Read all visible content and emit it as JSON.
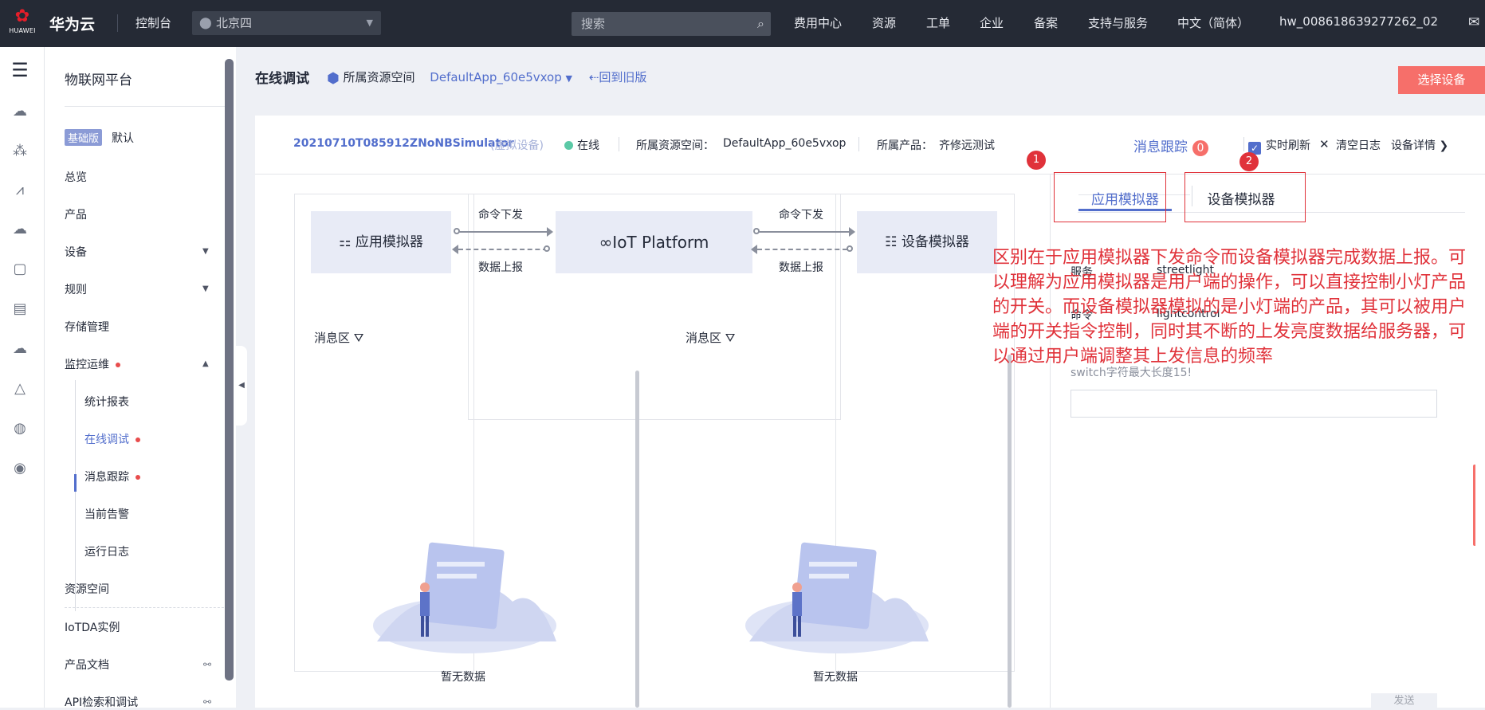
{
  "topbar": {
    "logo_text": "HUAWEI",
    "brand": "华为云",
    "console": "控制台",
    "region": "北京四",
    "search_placeholder": "搜索",
    "nav": [
      "费用中心",
      "资源",
      "工单",
      "企业",
      "备案",
      "支持与服务",
      "中文（简体）",
      "hw_008618639277262_02"
    ]
  },
  "sidenav": {
    "title": "物联网平台",
    "edition_badge": "基础版",
    "edition_label": "默认",
    "items": {
      "overview": "总览",
      "product": "产品",
      "device": "设备",
      "rules": "规则",
      "storage": "存储管理",
      "monitor": "监控运维",
      "resource_space": "资源空间",
      "iotda": "IoTDA实例",
      "docs": "产品文档",
      "api": "API检索和调试"
    },
    "sub_items": {
      "stats": "统计报表",
      "online_debug": "在线调试",
      "msg_trace": "消息跟踪",
      "alarms": "当前告警",
      "logs": "运行日志"
    }
  },
  "page": {
    "title": "在线调试",
    "resource_space_label": "所属资源空间",
    "app_name": "DefaultApp_60e5vxop",
    "back_old": "回到旧版",
    "select_device": "选择设备"
  },
  "devbar": {
    "device_id": "20210710T085912ZNoNBSimulator",
    "virtual": "(虚拟设备)",
    "status": "在线",
    "space_label": "所属资源空间：",
    "space_value": "DefaultApp_60e5vxop",
    "product_label": "所属产品：",
    "product_value": "齐修远测试",
    "trace_label": "消息跟踪",
    "trace_count": "0",
    "realtime": "实时刷新",
    "clear_log": "清空日志",
    "device_detail": "设备详情"
  },
  "diagram": {
    "app_sim": "应用模拟器",
    "platform": "IoT Platform",
    "dev_sim": "设备模拟器",
    "cmd_down": "命令下发",
    "data_up": "数据上报"
  },
  "message_area": {
    "title": "消息区",
    "empty": "暂无数据"
  },
  "simulator": {
    "tab_app": "应用模拟器",
    "tab_device": "设备模拟器",
    "marker1": "1",
    "marker2": "2",
    "service_label": "服务",
    "service_value": "streetlight",
    "command_label": "命令",
    "command_value": "lightcontrol",
    "hint": "switch字符最大长度15!",
    "send": "发送"
  },
  "annotation": "区别在于应用模拟器下发命令而设备模拟器完成数据上报。可以理解为应用模拟器是用户端的操作，可以直接控制小灯产品的开关。而设备模拟器模拟的是小灯端的产品，其可以被用户端的开关指令控制，同时其不断的上发亮度数据给服务器，可以通过用户端调整其上发信息的频率",
  "colors": {
    "topbar": "#252a35",
    "accent": "#526ecc",
    "primary_button": "#f66f6a",
    "annotation": "#e0323a",
    "online": "#5bc9a6"
  }
}
